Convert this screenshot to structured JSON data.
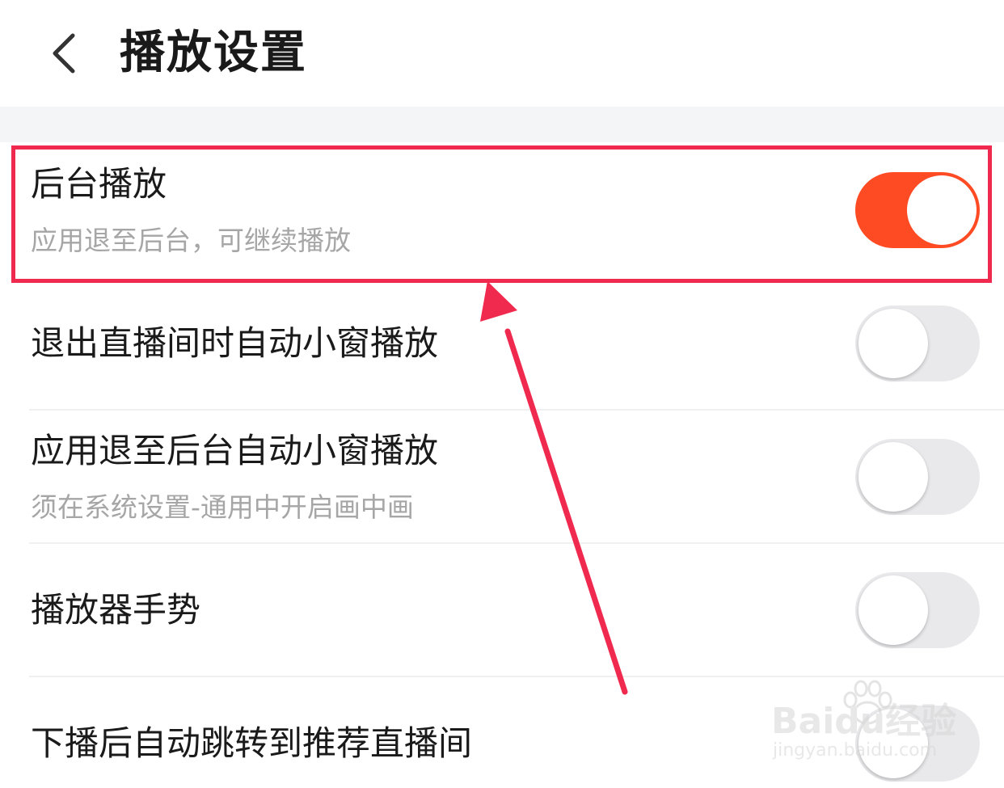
{
  "header": {
    "title": "播放设置",
    "back_icon": "chevron-left-icon"
  },
  "colors": {
    "accent": "#fe4b24",
    "highlight": "#f0294f",
    "toggle_off": "#e9e9eb",
    "subtitle": "#a6a6a6",
    "band": "#f4f5f7"
  },
  "settings": [
    {
      "title": "后台播放",
      "subtitle": "应用退至后台，可继续播放",
      "enabled": true
    },
    {
      "title": "退出直播间时自动小窗播放",
      "subtitle": "",
      "enabled": false
    },
    {
      "title": "应用退至后台自动小窗播放",
      "subtitle": "须在系统设置-通用中开启画中画",
      "enabled": false
    },
    {
      "title": "播放器手势",
      "subtitle": "",
      "enabled": false
    },
    {
      "title": "下播后自动跳转到推荐直播间",
      "subtitle": "",
      "enabled": false
    }
  ],
  "watermark": {
    "brand": "Baidu经验",
    "url": "jingyan.baidu.com"
  }
}
